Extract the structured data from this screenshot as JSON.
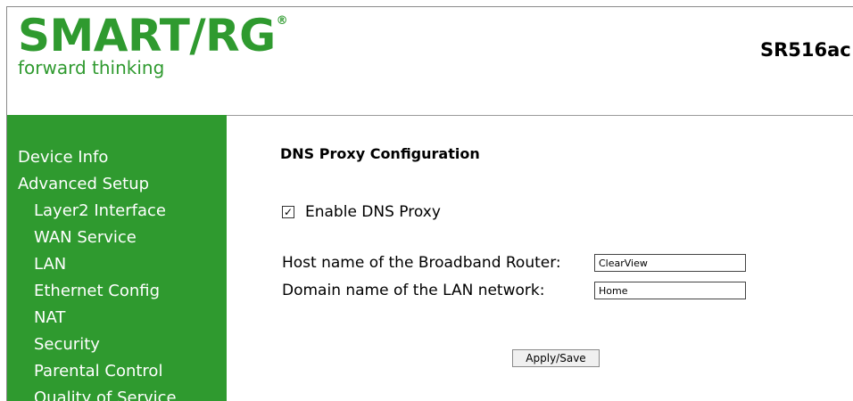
{
  "brand": {
    "logo_text": "SMART/RG",
    "logo_mark": "®",
    "tagline": "forward thinking",
    "model": "SR516ac",
    "color": "#2f9a2f"
  },
  "sidebar": {
    "items": [
      {
        "label": "Device Info",
        "level": "top"
      },
      {
        "label": "Advanced Setup",
        "level": "top"
      },
      {
        "label": "Layer2 Interface",
        "level": "sub"
      },
      {
        "label": "WAN Service",
        "level": "sub"
      },
      {
        "label": "LAN",
        "level": "sub"
      },
      {
        "label": "Ethernet Config",
        "level": "sub"
      },
      {
        "label": "NAT",
        "level": "sub"
      },
      {
        "label": "Security",
        "level": "sub"
      },
      {
        "label": "Parental Control",
        "level": "sub"
      },
      {
        "label": "Quality of Service",
        "level": "sub"
      }
    ]
  },
  "main": {
    "title": "DNS Proxy Configuration",
    "enable_label": "Enable DNS Proxy",
    "enable_checked": true,
    "host_label": "Host name of the Broadband Router:",
    "host_value": "ClearView",
    "domain_label": "Domain name of the LAN network:",
    "domain_value": "Home",
    "apply_label": "Apply/Save"
  }
}
